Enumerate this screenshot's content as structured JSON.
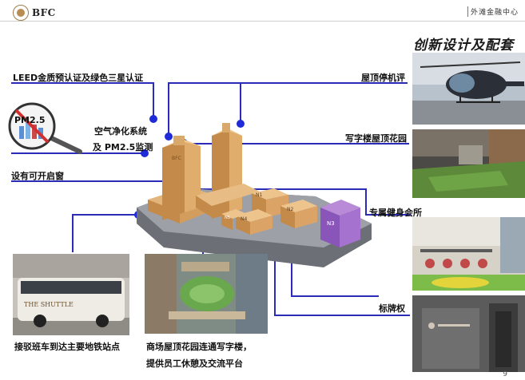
{
  "header": {
    "logo_text": "BFC",
    "top_right": "外滩金融中心"
  },
  "feature_title": "创新设计及配套",
  "labels": {
    "leed": "LEED金质预认证及绿色三星认证",
    "air_1": "空气净化系统",
    "air_2": "及 PM2.5监测",
    "windows": "设有可开启窗",
    "shuttle": "接驳班车到达主要地铁站点",
    "mall_1": "商场屋顶花园连通写字楼，",
    "mall_2": "提供员工休憩及交流平台",
    "helipad": "屋顶停机评",
    "roof_garden": "写字楼屋顶花园",
    "gym": "专属健身会所",
    "signage": "标牌权"
  },
  "pm_badge": "PM2.5",
  "building": {
    "tower_label": "BFC",
    "blocks": [
      "N1",
      "N2",
      "N3",
      "N4",
      "N5"
    ]
  },
  "bus_text": "THE SHUTTLE",
  "page_number": "9",
  "colors": {
    "connector": "#2a2cb8",
    "dot": "#1f2ad8",
    "tower": "#d9a96b",
    "purple_block": "#9a63c4"
  }
}
